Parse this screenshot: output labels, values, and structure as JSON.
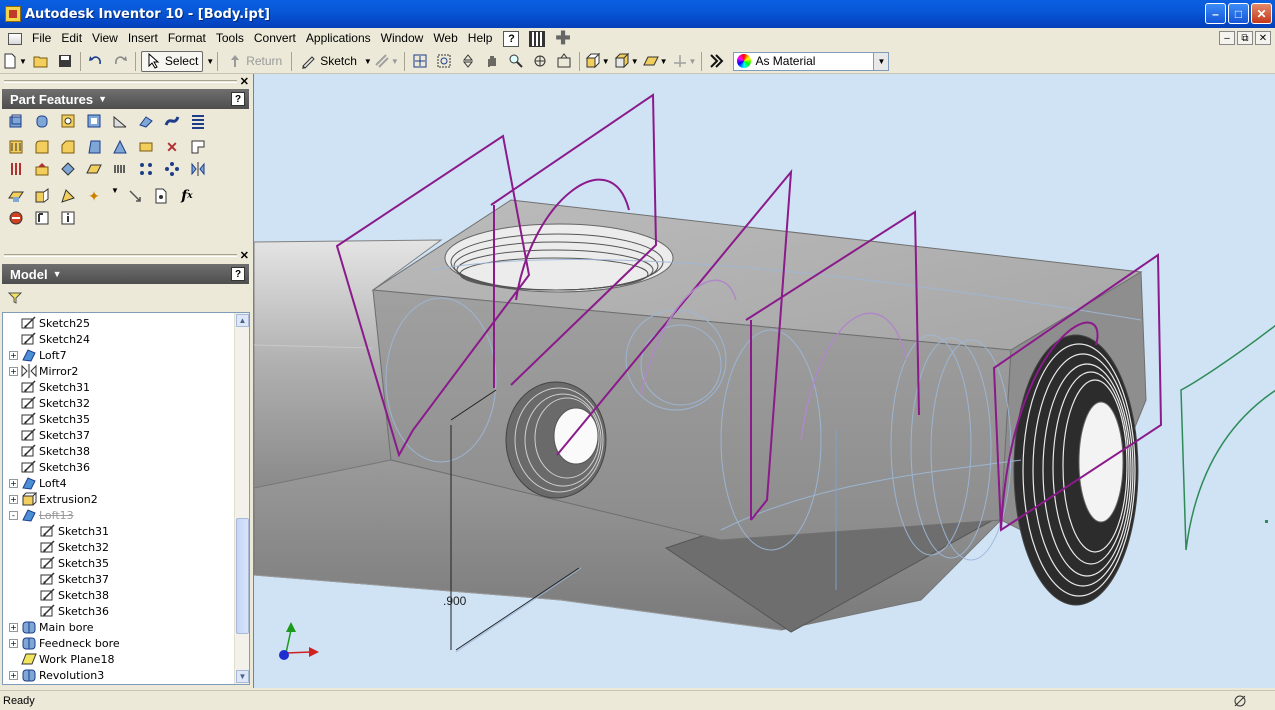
{
  "window": {
    "title": "Autodesk Inventor 10 - [Body.ipt]"
  },
  "menu": [
    "File",
    "Edit",
    "View",
    "Insert",
    "Format",
    "Tools",
    "Convert",
    "Applications",
    "Window",
    "Web",
    "Help"
  ],
  "toolbar": {
    "select_label": "Select",
    "return_label": "Return",
    "sketch_label": "Sketch",
    "appearance": "As Material"
  },
  "panels": {
    "features_title": "Part Features",
    "model_title": "Model"
  },
  "tree": [
    {
      "label": "Sketch25",
      "indent": 0,
      "icon": "sketch-icon",
      "expander": ""
    },
    {
      "label": "Sketch24",
      "indent": 0,
      "icon": "sketch-icon",
      "expander": ""
    },
    {
      "label": "Loft7",
      "indent": 0,
      "icon": "loft-icon",
      "expander": "+"
    },
    {
      "label": "Mirror2",
      "indent": 0,
      "icon": "mirror-icon",
      "expander": "+"
    },
    {
      "label": "Sketch31",
      "indent": 0,
      "icon": "sketch-icon",
      "expander": ""
    },
    {
      "label": "Sketch32",
      "indent": 0,
      "icon": "sketch-icon",
      "expander": ""
    },
    {
      "label": "Sketch35",
      "indent": 0,
      "icon": "sketch-icon",
      "expander": ""
    },
    {
      "label": "Sketch37",
      "indent": 0,
      "icon": "sketch-icon",
      "expander": ""
    },
    {
      "label": "Sketch38",
      "indent": 0,
      "icon": "sketch-icon",
      "expander": ""
    },
    {
      "label": "Sketch36",
      "indent": 0,
      "icon": "sketch-icon",
      "expander": ""
    },
    {
      "label": "Loft4",
      "indent": 0,
      "icon": "loft-icon",
      "expander": "+"
    },
    {
      "label": "Extrusion2",
      "indent": 0,
      "icon": "extrusion-icon",
      "expander": "+"
    },
    {
      "label": "Loft13",
      "indent": 0,
      "icon": "loft-icon",
      "expander": "-",
      "suppressed": true
    },
    {
      "label": "Sketch31",
      "indent": 1,
      "icon": "sketch-icon",
      "expander": ""
    },
    {
      "label": "Sketch32",
      "indent": 1,
      "icon": "sketch-icon",
      "expander": ""
    },
    {
      "label": "Sketch35",
      "indent": 1,
      "icon": "sketch-icon",
      "expander": ""
    },
    {
      "label": "Sketch37",
      "indent": 1,
      "icon": "sketch-icon",
      "expander": ""
    },
    {
      "label": "Sketch38",
      "indent": 1,
      "icon": "sketch-icon",
      "expander": ""
    },
    {
      "label": "Sketch36",
      "indent": 1,
      "icon": "sketch-icon",
      "expander": ""
    },
    {
      "label": "Main bore",
      "indent": 0,
      "icon": "revolve-icon",
      "expander": "+"
    },
    {
      "label": "Feedneck bore",
      "indent": 0,
      "icon": "revolve-icon",
      "expander": "+"
    },
    {
      "label": "Work Plane18",
      "indent": 0,
      "icon": "work-plane-icon",
      "expander": ""
    },
    {
      "label": "Revolution3",
      "indent": 0,
      "icon": "revolve-icon",
      "expander": "+"
    }
  ],
  "viewport": {
    "dimension_label": ".900"
  },
  "status": {
    "text": "Ready"
  },
  "colors": {
    "title_bar": "#0A5FE0",
    "viewport_bg": "#CFE3F5",
    "sketch_profile": "#8B1A8B",
    "hidden_lines": "#9DB8D8",
    "panel_header": "#5A5A5A"
  }
}
